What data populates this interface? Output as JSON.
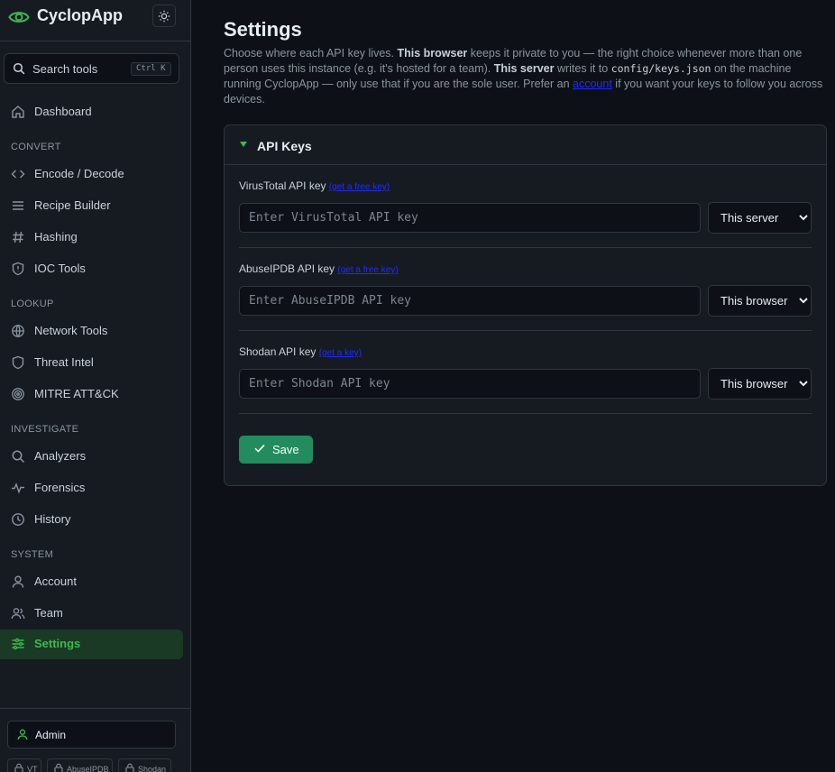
{
  "app": {
    "name": "CyclopApp",
    "accent": "#3fb950"
  },
  "search": {
    "placeholder": "Search tools",
    "shortcut": "Ctrl K"
  },
  "nav": {
    "dashboard": "Dashboard",
    "sections": {
      "convert": "CONVERT",
      "lookup": "LOOKUP",
      "investigate": "INVESTIGATE",
      "system": "SYSTEM"
    },
    "items": {
      "encode_decode": "Encode / Decode",
      "recipe_builder": "Recipe Builder",
      "hashing": "Hashing",
      "ioc_tools": "IOC Tools",
      "network_tools": "Network Tools",
      "threat_intel": "Threat Intel",
      "mitre": "MITRE ATT&CK",
      "analyzers": "Analyzers",
      "forensics": "Forensics",
      "history": "History",
      "account": "Account",
      "team": "Team",
      "settings": "Settings"
    },
    "active": "settings"
  },
  "footer": {
    "user": "Admin",
    "chips": [
      "VT",
      "AbuseIPDB",
      "Shodan"
    ]
  },
  "page": {
    "title": "Settings",
    "intro": {
      "p1": "Choose where each API key lives. ",
      "b1": "This browser",
      "p2": " keeps it private to you — the right choice whenever more than one person uses this instance (e.g. it's hosted for a team). ",
      "b2": "This server",
      "p3": " writes it to ",
      "code": "config/keys.json",
      "p4": " on the machine running CyclopApp — only use that if you are the sole user. Prefer an ",
      "link": "account",
      "p5": " if you want your keys to follow you across devices."
    }
  },
  "api_keys": {
    "title": "API Keys",
    "options": [
      "This browser",
      "This server"
    ],
    "keys": [
      {
        "label": "VirusTotal API key",
        "link": "(get a free key)",
        "placeholder": "Enter VirusTotal API key",
        "value": "",
        "storage": "This server"
      },
      {
        "label": "AbuseIPDB API key",
        "link": "(get a free key)",
        "placeholder": "Enter AbuseIPDB API key",
        "value": "",
        "storage": "This browser"
      },
      {
        "label": "Shodan API key",
        "link": "(get a key)",
        "placeholder": "Enter Shodan API key",
        "value": "",
        "storage": "This browser"
      }
    ],
    "save_label": "Save"
  }
}
